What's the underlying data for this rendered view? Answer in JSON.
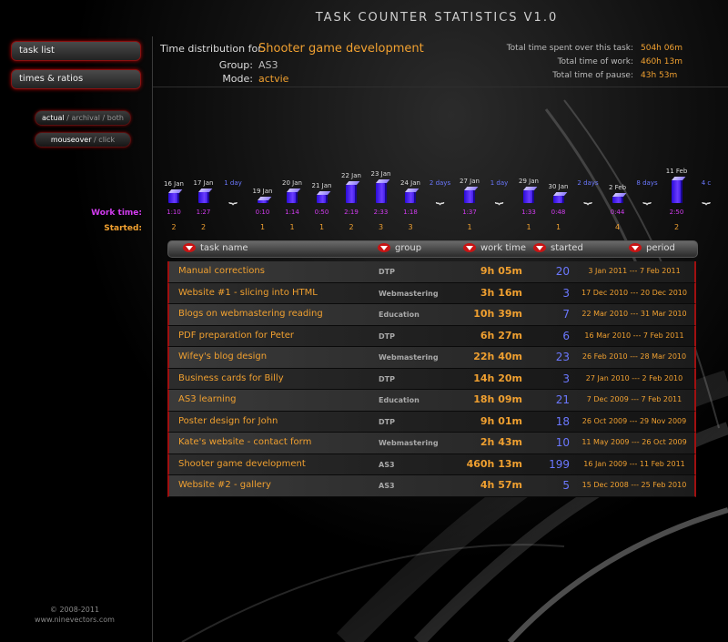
{
  "app_title": "TASK COUNTER STATISTICS V1.0",
  "sidebar": {
    "task_list": "task list",
    "times_ratios": "times & ratios",
    "view_mode": {
      "active": "actual",
      "rest": " / archival / both"
    },
    "trigger_mode": {
      "active": "mouseover",
      "rest": " / click"
    },
    "work_time_label": "Work time:",
    "started_label": "Started:",
    "copyright": "© 2008-2011",
    "website": "www.ninevectors.com"
  },
  "info": {
    "time_dist_label": "Time distribution for:",
    "task_name": "Shooter game development",
    "group_label": "Group:",
    "group_value": "AS3",
    "mode_label": "Mode:",
    "mode_value": "actvie"
  },
  "totals": {
    "spent_label": "Total time spent over this task:",
    "spent_value": "504h 06m",
    "work_label": "Total time of work:",
    "work_value": "460h 13m",
    "pause_label": "Total time of pause:",
    "pause_value": "43h 53m"
  },
  "timeline": {
    "items": [
      {
        "date": "16 Jan",
        "time": "1:10",
        "started": "2",
        "level": 0.3
      },
      {
        "date": "17 Jan",
        "time": "1:27",
        "started": "2",
        "level": 0.34
      },
      {
        "gap": "1 day"
      },
      {
        "date": "19 Jan",
        "time": "0:10",
        "started": "1",
        "level": 0.08
      },
      {
        "date": "20 Jan",
        "time": "1:14",
        "started": "1",
        "level": 0.32
      },
      {
        "date": "21 Jan",
        "time": "0:50",
        "started": "1",
        "level": 0.25
      },
      {
        "date": "22 Jan",
        "time": "2:19",
        "started": "2",
        "level": 0.55
      },
      {
        "date": "23 Jan",
        "time": "2:33",
        "started": "3",
        "level": 0.6
      },
      {
        "date": "24 Jan",
        "time": "1:18",
        "started": "3",
        "level": 0.32
      },
      {
        "gap": "2 days"
      },
      {
        "date": "27 Jan",
        "time": "1:37",
        "started": "1",
        "level": 0.4
      },
      {
        "gap": "1 day"
      },
      {
        "date": "29 Jan",
        "time": "1:33",
        "started": "1",
        "level": 0.38
      },
      {
        "date": "30 Jan",
        "time": "0:48",
        "started": "1",
        "level": 0.22
      },
      {
        "gap": "2 days"
      },
      {
        "date": "2 Feb",
        "time": "0:44",
        "started": "4",
        "level": 0.2
      },
      {
        "gap": "8 days"
      },
      {
        "date": "11 Feb",
        "time": "2:50",
        "started": "2",
        "level": 0.7
      },
      {
        "gap": "4 c"
      }
    ]
  },
  "table": {
    "headers": [
      "task name",
      "group",
      "work time",
      "started",
      "period"
    ],
    "rows": [
      {
        "name": "Manual corrections",
        "group": "DTP",
        "work": "9h 05m",
        "started": "20",
        "period": "3 Jan 2011 --- 7 Feb 2011"
      },
      {
        "name": "Website #1 - slicing into HTML",
        "group": "Webmastering",
        "work": "3h 16m",
        "started": "3",
        "period": "17 Dec 2010 --- 20 Dec 2010"
      },
      {
        "name": "Blogs on webmastering reading",
        "group": "Education",
        "work": "10h 39m",
        "started": "7",
        "period": "22 Mar 2010 --- 31 Mar 2010"
      },
      {
        "name": "PDF preparation for Peter",
        "group": "DTP",
        "work": "6h 27m",
        "started": "6",
        "period": "16 Mar 2010 --- 7 Feb 2011"
      },
      {
        "name": "Wifey's blog design",
        "group": "Webmastering",
        "work": "22h 40m",
        "started": "23",
        "period": "26 Feb 2010 --- 28 Mar 2010"
      },
      {
        "name": "Business cards for Billy",
        "group": "DTP",
        "work": "14h 20m",
        "started": "3",
        "period": "27 Jan 2010 --- 2 Feb 2010"
      },
      {
        "name": "AS3 learning",
        "group": "Education",
        "work": "18h 09m",
        "started": "21",
        "period": "7 Dec 2009 --- 7 Feb 2011"
      },
      {
        "name": "Poster design for John",
        "group": "DTP",
        "work": "9h 01m",
        "started": "18",
        "period": "26 Oct 2009 --- 29 Nov 2009"
      },
      {
        "name": "Kate's website - contact form",
        "group": "Webmastering",
        "work": "2h 43m",
        "started": "10",
        "period": "11 May 2009 --- 26 Oct 2009"
      },
      {
        "name": "Shooter game development",
        "group": "AS3",
        "work": "460h 13m",
        "started": "199",
        "period": "16 Jan 2009 --- 11 Feb 2011"
      },
      {
        "name": "Website #2 - gallery",
        "group": "AS3",
        "work": "4h 57m",
        "started": "5",
        "period": "15 Dec 2008 --- 25 Feb 2010"
      }
    ]
  }
}
